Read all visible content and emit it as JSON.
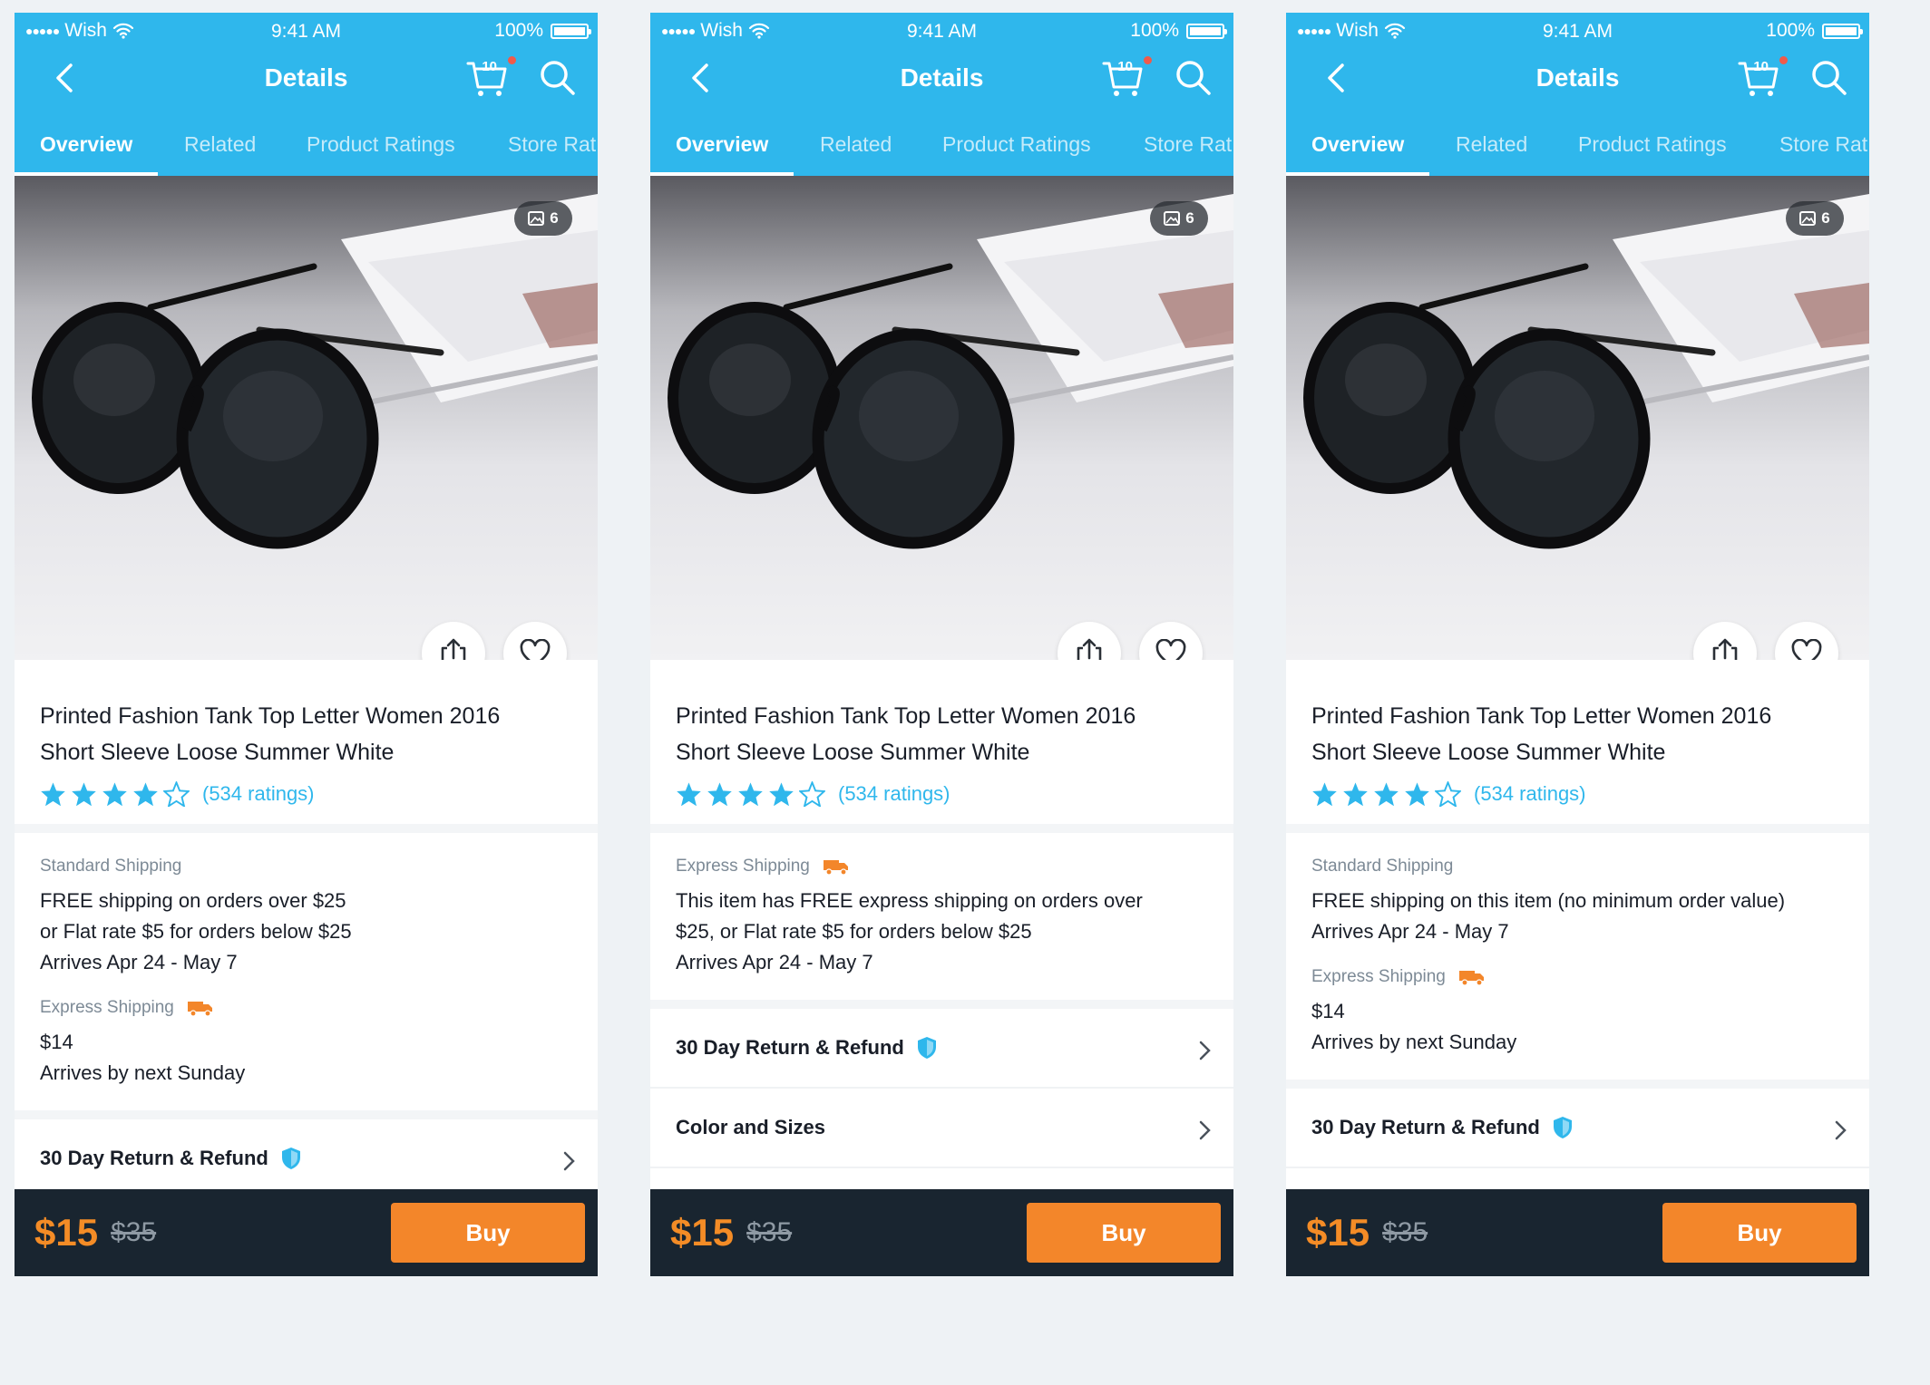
{
  "colors": {
    "brand_blue": "#2fb7ec",
    "accent_orange": "#f3862a",
    "footer_dark": "#192530",
    "link_blue": "#2fb7ec"
  },
  "icons": [
    "signal-dots-icon",
    "wifi-icon",
    "battery-icon",
    "back-chevron-icon",
    "cart-icon",
    "search-icon",
    "gallery-icon",
    "share-icon",
    "heart-icon",
    "star-icon",
    "truck-icon",
    "shield-icon",
    "chevron-right-icon"
  ],
  "screens": [
    {
      "status": {
        "carrier": "Wish",
        "time": "9:41 AM",
        "battery": "100%"
      },
      "header": {
        "title": "Details",
        "cart_count": "10"
      },
      "tabs": [
        {
          "label": "Overview"
        },
        {
          "label": "Related"
        },
        {
          "label": "Product Ratings"
        },
        {
          "label": "Store Rat"
        }
      ],
      "photo_count": "6",
      "product": {
        "title_line1": "Printed Fashion Tank Top Letter Women 2016",
        "title_line2": "Short Sleeve Loose Summer White",
        "stars": 4,
        "ratings": "(534 ratings)"
      },
      "shipping": {
        "standard_label": "Standard Shipping",
        "standard_lines": [
          "FREE shipping on orders over $25",
          "or Flat rate $5 for orders below $25",
          "Arrives Apr 24 - May 7"
        ],
        "express_label": "Express Shipping",
        "express_lines": [
          "$14",
          "Arrives by next Sunday"
        ]
      },
      "rows": [
        {
          "label": "30 Day Return & Refund"
        }
      ],
      "footer": {
        "price": "$15",
        "old_price": "$35",
        "buy": "Buy"
      }
    },
    {
      "status": {
        "carrier": "Wish",
        "time": "9:41 AM",
        "battery": "100%"
      },
      "header": {
        "title": "Details",
        "cart_count": "10"
      },
      "tabs": [
        {
          "label": "Overview"
        },
        {
          "label": "Related"
        },
        {
          "label": "Product Ratings"
        },
        {
          "label": "Store Rat"
        }
      ],
      "photo_count": "6",
      "product": {
        "title_line1": "Printed Fashion Tank Top Letter Women 2016",
        "title_line2": "Short Sleeve Loose Summer White",
        "stars": 4,
        "ratings": "(534 ratings)"
      },
      "shipping": {
        "express_label": "Express Shipping",
        "express_lines": [
          "This item has FREE express shipping on orders over",
          "$25, or Flat rate $5 for orders below $25",
          "Arrives Apr 24 - May 7"
        ]
      },
      "rows": [
        {
          "label": "30 Day Return & Refund"
        },
        {
          "label": "Color and Sizes"
        }
      ],
      "footer": {
        "price": "$15",
        "old_price": "$35",
        "buy": "Buy"
      }
    },
    {
      "status": {
        "carrier": "Wish",
        "time": "9:41 AM",
        "battery": "100%"
      },
      "header": {
        "title": "Details",
        "cart_count": "10"
      },
      "tabs": [
        {
          "label": "Overview"
        },
        {
          "label": "Related"
        },
        {
          "label": "Product Ratings"
        },
        {
          "label": "Store Rat"
        }
      ],
      "photo_count": "6",
      "product": {
        "title_line1": "Printed Fashion Tank Top Letter Women 2016",
        "title_line2": "Short Sleeve Loose Summer White",
        "stars": 4,
        "ratings": "(534 ratings)"
      },
      "shipping": {
        "standard_label": "Standard Shipping",
        "standard_lines": [
          "FREE shipping on this item (no minimum order value)",
          "Arrives Apr 24 - May 7"
        ],
        "express_label": "Express Shipping",
        "express_lines": [
          "$14",
          "Arrives by next Sunday"
        ]
      },
      "rows": [
        {
          "label": "30 Day Return & Refund"
        }
      ],
      "footer": {
        "price": "$15",
        "old_price": "$35",
        "buy": "Buy"
      }
    }
  ]
}
